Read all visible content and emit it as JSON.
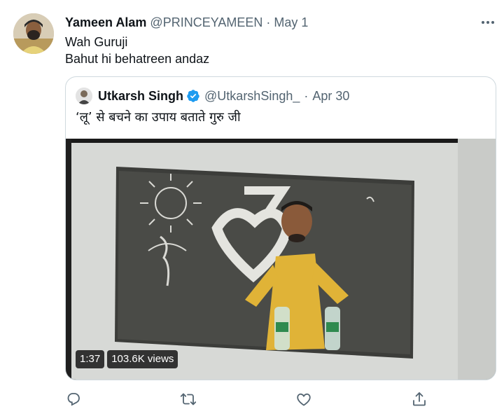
{
  "tweet": {
    "author": {
      "name": "Yameen Alam",
      "handle": "@PRINCEYAMEEN",
      "separator": "·",
      "date": "May 1",
      "avatar": "user-avatar"
    },
    "text_lines": [
      "Wah Guruji",
      "Bahut hi behatreen andaz"
    ],
    "more_icon": "ellipsis-icon",
    "quoted": {
      "name": "Utkarsh Singh",
      "verified_icon": "verified-badge-icon",
      "handle": "@UtkarshSingh_",
      "separator": "·",
      "date": "Apr 30",
      "text": "‘लू’ से बचने का उपाय बताते गुरु जी",
      "media": {
        "type": "video",
        "description_icon": "video-thumbnail",
        "duration": "1:37",
        "views": "103.6K views"
      }
    },
    "actions": {
      "reply_icon": "reply-icon",
      "retweet_icon": "retweet-icon",
      "like_icon": "heart-icon",
      "share_icon": "share-icon"
    }
  },
  "colors": {
    "text": "#0f1419",
    "secondary": "#536471",
    "border": "#cfd9de",
    "verified": "#1d9bf0"
  }
}
